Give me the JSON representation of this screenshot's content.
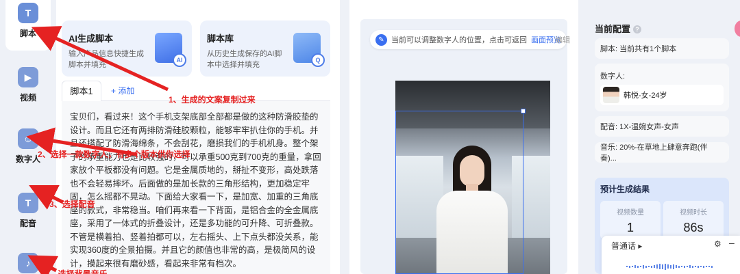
{
  "rail": {
    "items": [
      {
        "label": "脚本"
      },
      {
        "label": "视频"
      },
      {
        "label": "数字人"
      },
      {
        "label": "配音"
      }
    ]
  },
  "cards": {
    "ai": {
      "title": "AI生成脚本",
      "desc": "输入产品信息快捷生成脚本并填充"
    },
    "library": {
      "title": "脚本库",
      "desc": "从历史生成保存的AI脚本中选择并填充"
    }
  },
  "tabs": {
    "script1": "脚本1",
    "add": "+ 添加"
  },
  "script_text": "宝贝们，看过来！这个手机支架底部全部都是做的这种防滑胶垫的设计。而且它还有两排防滑硅胶颗粒，能够牢牢扒住你的手机。并且还搭配了防滑海绵条，不会刮花，磨损我们的手机机身。整个架子的承重能力也是比较强的，可以承重500克到700克的重量，拿回家放个平板都没有问题。它是金属质地的，掰扯不变形，高处跌落也不会轻易摔坏。后面做的是加长款的三角形结构，更加稳定牢固，怎么摇都不晃动。下面给大家看一下，是加宽、加重的三角底座的款式，非常稳当。咱们再来看一下背面，是铝合金的全金属底座，采用了一体式的折叠设计，还是多功能的可升降、可折叠款。不管是横着拍、竖着拍都可以，左右摇头、上下点头都没关系，能实现360度的全景拍摄。并且它的颜值也非常的高，是极简风的设计，摸起来很有磨砂感，看起来非常有档次。",
  "preview": {
    "tip": "当前可以调整数字人的位置，点击可返回",
    "tip_link": "画面预览",
    "edit": "编辑"
  },
  "config": {
    "title": "当前配置",
    "script": "脚本: 当前共有1个脚本",
    "avatar_label": "数字人:",
    "avatar_name": "韩悦-女-24岁",
    "voice": "配音: 1X-温婉女声-女声",
    "music": "音乐: 20%-在草地上肆意奔跑(伴奏)...",
    "estimate_title": "预计生成结果",
    "video_count_label": "视频数量",
    "video_count": "1",
    "video_duration_label": "视频时长",
    "video_duration": "86s"
  },
  "popup": {
    "voice_title": "普通话 ▸"
  },
  "annotations": {
    "a1": "1、生成的文案复制过来",
    "a2": "2、选择一款数字人，有多个版本供你选择",
    "a3": "3、选择配音",
    "a4": "4、选择背景音乐"
  },
  "colors": {
    "accent": "#3a6ff0",
    "annotation": "#e52222"
  }
}
